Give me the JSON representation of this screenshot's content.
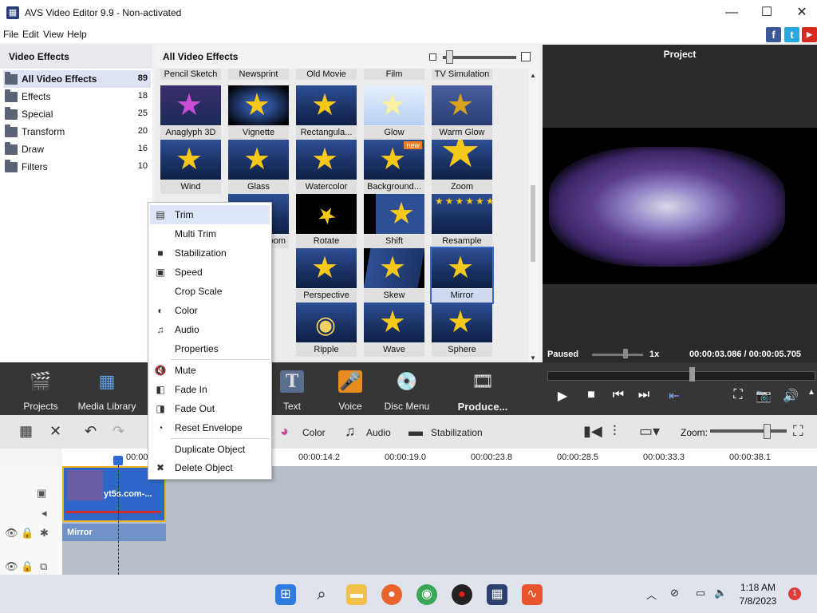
{
  "window": {
    "title": "AVS Video Editor 9.9 - Non-activated",
    "minimize": "—",
    "maximize": "☐",
    "close": "✕"
  },
  "menu": [
    "File",
    "Edit",
    "View",
    "Help"
  ],
  "social": {
    "facebook": "f",
    "twitter": "t",
    "youtube": "▶"
  },
  "left_panel": {
    "title": "Video Effects",
    "categories": [
      {
        "label": "All Video Effects",
        "count": "89"
      },
      {
        "label": "Effects",
        "count": "18"
      },
      {
        "label": "Special",
        "count": "25"
      },
      {
        "label": "Transform",
        "count": "20"
      },
      {
        "label": "Draw",
        "count": "16"
      },
      {
        "label": "Filters",
        "count": "10"
      }
    ]
  },
  "grid": {
    "title": "All Video Effects",
    "top_row": [
      "Pencil Sketch",
      "Newsprint",
      "Old Movie",
      "Film",
      "TV Simulation"
    ],
    "rows": [
      [
        "Anaglyph 3D",
        "Vignette",
        "Rectangula...",
        "Glow",
        "Warm Glow"
      ],
      [
        "Wind",
        "Glass",
        "Watercolor",
        "Background...",
        "Zoom"
      ],
      [
        "",
        "oom",
        "Rotate",
        "Shift",
        "Resample"
      ],
      [
        "",
        "",
        "Perspective",
        "Skew",
        "Mirror"
      ],
      [
        "",
        "",
        "Ripple",
        "Wave",
        "Sphere"
      ]
    ],
    "new_badge": "new",
    "selected": "Mirror"
  },
  "project": {
    "title": "Project",
    "status": "Paused",
    "speed": "1x",
    "timecode": "00:00:03.086 / 00:00:05.705"
  },
  "toolbar": {
    "buttons": [
      "Projects",
      "Media Library",
      "Text",
      "Voice",
      "Disc Menu",
      "Produce..."
    ]
  },
  "edit_toolbar": {
    "color": "Color",
    "audio": "Audio",
    "stabilization": "Stabilization",
    "zoom": "Zoom:"
  },
  "timeline": {
    "ticks": [
      "00:00",
      "00:00:14.2",
      "00:00:19.0",
      "00:00:23.8",
      "00:00:28.5",
      "00:00:33.3",
      "00:00:38.1"
    ],
    "clip_name": "yt5s.com-...",
    "effect_clip": "Mirror"
  },
  "context_menu": {
    "group1": [
      "Trim",
      "Multi Trim",
      "Stabilization",
      "Speed",
      "Crop Scale",
      "Color",
      "Audio",
      "Properties"
    ],
    "group2": [
      "Mute",
      "Fade In",
      "Fade Out",
      "Reset Envelope"
    ],
    "group3": [
      "Duplicate Object",
      "Delete Object"
    ]
  },
  "taskbar": {
    "time": "1:18 AM",
    "date": "7/8/2023",
    "notifications": "1"
  }
}
